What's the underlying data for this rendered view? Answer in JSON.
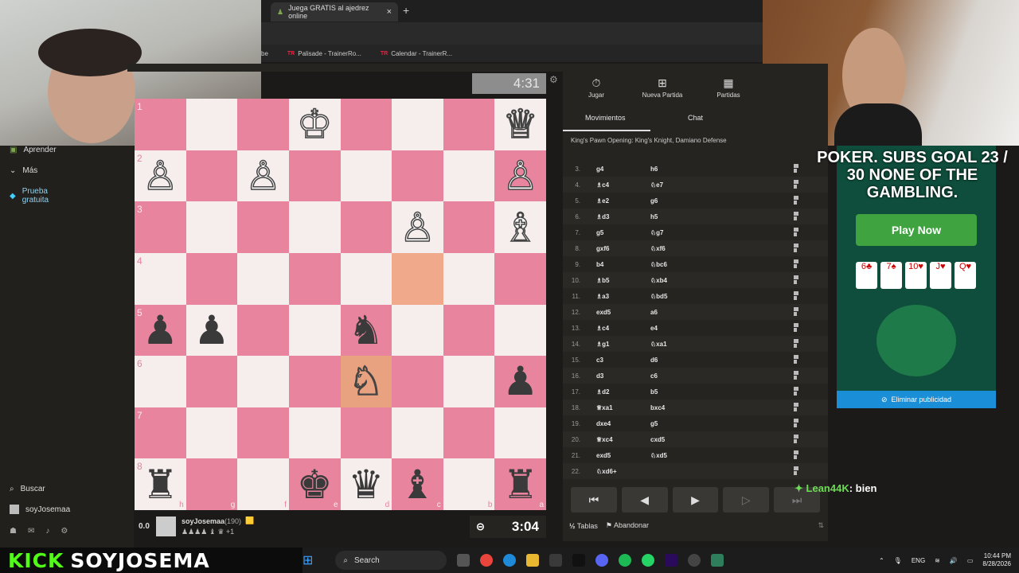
{
  "browser": {
    "tab_title": "Juega GRATIS al ajedrez online",
    "bookmarks": [
      "be",
      "Palisade - TrainerRo...",
      "Calendar - TrainerR..."
    ]
  },
  "sidebar": {
    "items": [
      {
        "label": "Aprender",
        "icon": "graduation-icon"
      },
      {
        "label": "Más",
        "icon": "chevron-down-icon"
      },
      {
        "label": "Prueba gratuita",
        "icon": "diamond-icon"
      }
    ],
    "search_label": "Buscar",
    "user": "soyJosemaa"
  },
  "board": {
    "ranks": [
      "1",
      "2",
      "3",
      "4",
      "5",
      "6",
      "7",
      "8"
    ],
    "files": [
      "h",
      "g",
      "f",
      "e",
      "d",
      "c",
      "b",
      "a"
    ],
    "rows": [
      [
        "",
        "",
        "",
        "♔",
        "",
        "",
        "",
        "♕"
      ],
      [
        "♙",
        "",
        "♙",
        "",
        "",
        "",
        "",
        "♙"
      ],
      [
        "",
        "",
        "",
        "",
        "",
        "♙",
        "",
        "♗"
      ],
      [
        "",
        "",
        "",
        "",
        "",
        "",
        "",
        ""
      ],
      [
        "♟",
        "♟",
        "",
        "",
        "♞",
        "",
        "",
        ""
      ],
      [
        "",
        "",
        "",
        "",
        "♘",
        "",
        "",
        "♟"
      ],
      [
        "",
        "",
        "",
        "",
        "",
        "",
        "",
        ""
      ],
      [
        "♜",
        "",
        "",
        "♚",
        "♛",
        "♝",
        "",
        "♜"
      ]
    ],
    "highlights": [
      [
        3,
        5
      ],
      [
        5,
        4
      ]
    ],
    "top_clock": "4:31",
    "bottom_clock": "3:04",
    "eval": "0.0",
    "player_name": "soyJosemaa",
    "player_rating": "(190)",
    "captured": "♟♟♟♟ ♝ ♛ +1"
  },
  "panel": {
    "tabs": [
      {
        "label": "Jugar",
        "icon": "stopwatch-icon"
      },
      {
        "label": "Nueva Partida",
        "icon": "plus-icon"
      },
      {
        "label": "Partidas",
        "icon": "grid-icon"
      }
    ],
    "subtabs": [
      "Movimientos",
      "Chat"
    ],
    "opening": "King's Pawn Opening: King's Knight, Damiano Defense",
    "moves": [
      {
        "n": "3.",
        "w": "g4",
        "b": "h6"
      },
      {
        "n": "4.",
        "w": "♗c4",
        "b": "♘e7"
      },
      {
        "n": "5.",
        "w": "♗e2",
        "b": "g6"
      },
      {
        "n": "6.",
        "w": "♗d3",
        "b": "h5"
      },
      {
        "n": "7.",
        "w": "g5",
        "b": "♘g7"
      },
      {
        "n": "8.",
        "w": "gxf6",
        "b": "♘xf6"
      },
      {
        "n": "9.",
        "w": "b4",
        "b": "♘bc6"
      },
      {
        "n": "10.",
        "w": "♗b5",
        "b": "♘xb4"
      },
      {
        "n": "11.",
        "w": "♗a3",
        "b": "♘bd5"
      },
      {
        "n": "12.",
        "w": "exd5",
        "b": "a6"
      },
      {
        "n": "13.",
        "w": "♗c4",
        "b": "e4"
      },
      {
        "n": "14.",
        "w": "♗g1",
        "b": "♘xa1"
      },
      {
        "n": "15.",
        "w": "c3",
        "b": "d6"
      },
      {
        "n": "16.",
        "w": "d3",
        "b": "c6"
      },
      {
        "n": "17.",
        "w": "♗d2",
        "b": "b5"
      },
      {
        "n": "18.",
        "w": "♕xa1",
        "b": "bxc4"
      },
      {
        "n": "19.",
        "w": "dxe4",
        "b": "g5"
      },
      {
        "n": "20.",
        "w": "♕xc4",
        "b": "cxd5"
      },
      {
        "n": "21.",
        "w": "exd5",
        "b": "♘xd5"
      },
      {
        "n": "22.",
        "w": "♘xd6+",
        "b": ""
      }
    ],
    "draw_label": "Tablas",
    "draw_prefix": "½",
    "resign_label": "Abandonar"
  },
  "ad": {
    "headline": "POKER. SUBS GOAL 23 / 30 NONE OF THE GAMBLING.",
    "cta": "Play Now",
    "cards": [
      "6♣",
      "7♠",
      "10♥",
      "J♥",
      "Q♥"
    ],
    "remove_label": "Eliminar publicidad"
  },
  "chat": {
    "user": "Lean44K",
    "message": ": bien"
  },
  "stream": {
    "brand": "KICK",
    "channel": "SOYJOSEMA"
  },
  "taskbar": {
    "search": "Search",
    "lang": "ENG",
    "time": "10:44 PM",
    "date": "8/28/2026"
  },
  "colors": {
    "light_square": "#f6eded",
    "dark_square": "#e8849e",
    "accent_green": "#53fc18"
  }
}
